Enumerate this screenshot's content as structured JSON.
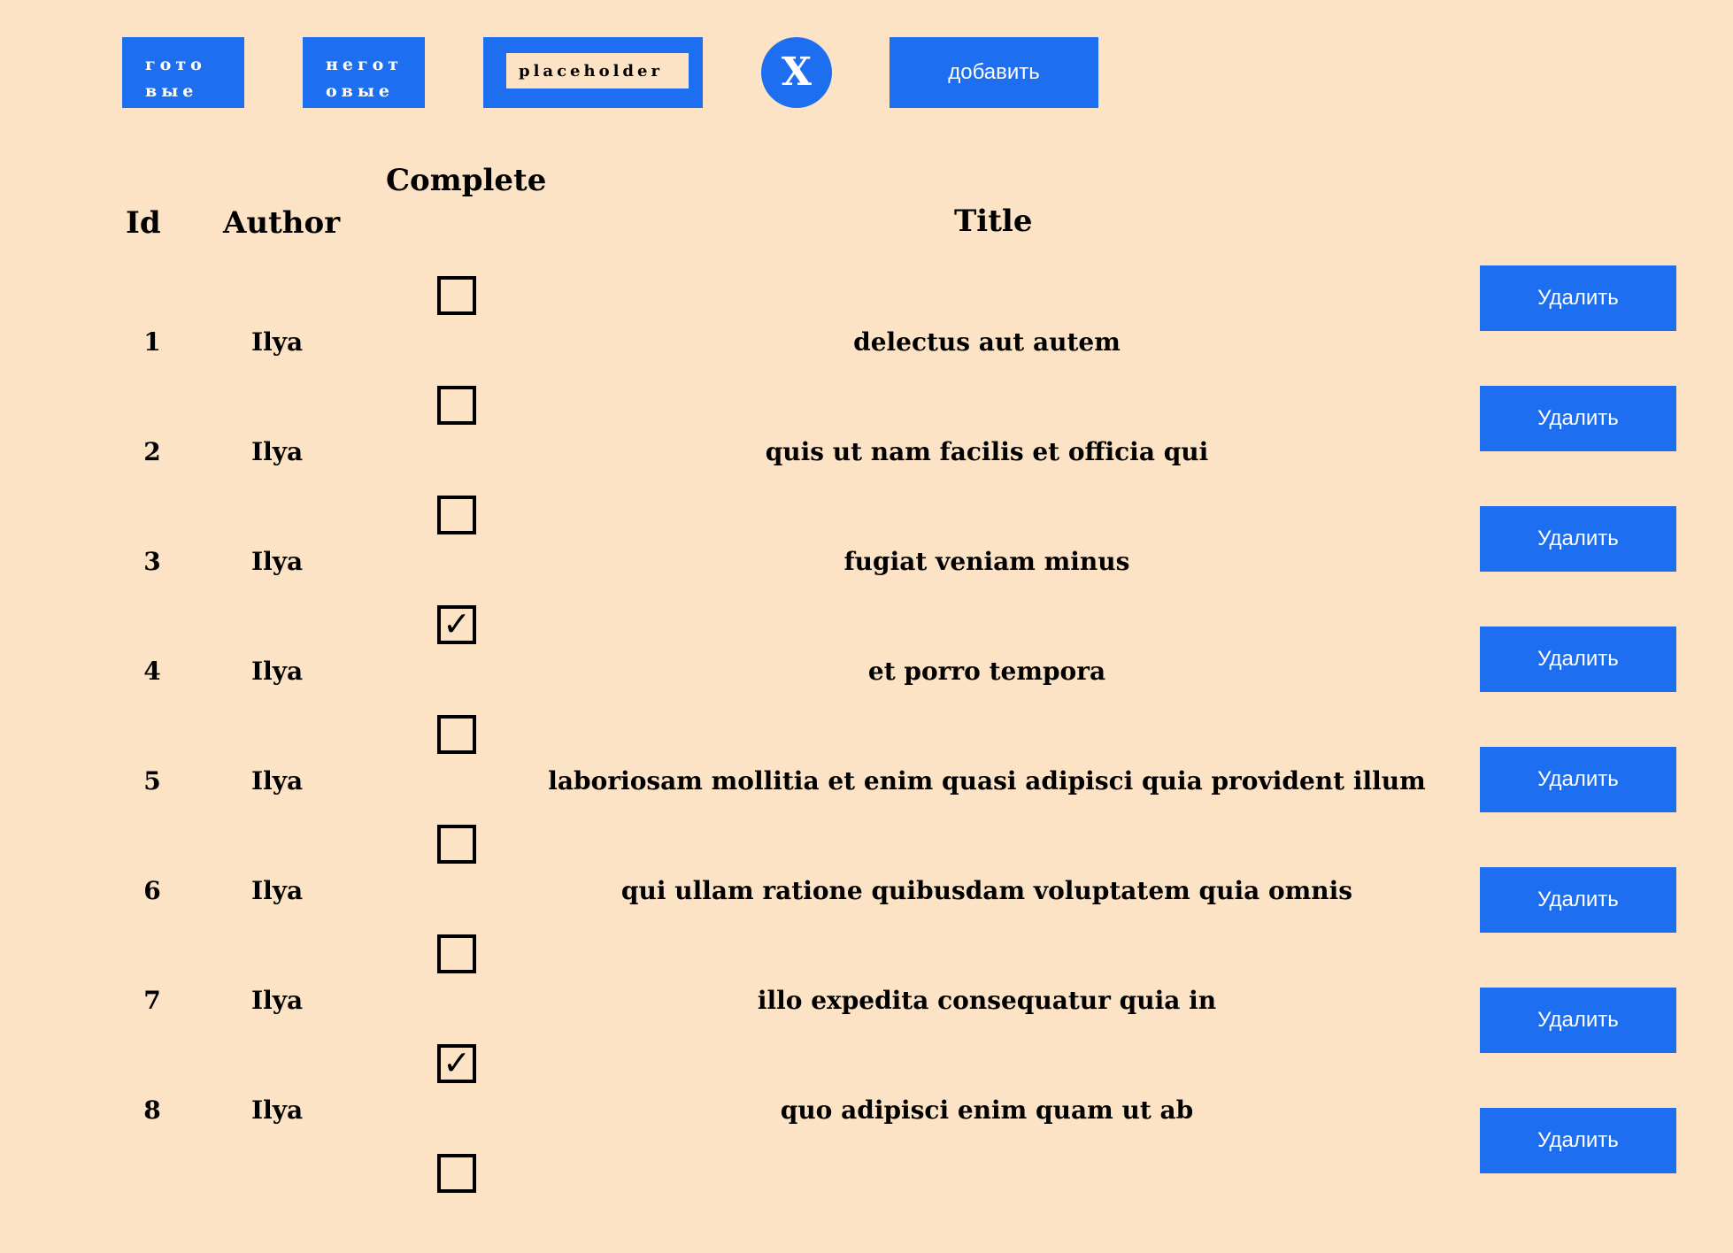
{
  "toolbar": {
    "filter_done_line1": "гото",
    "filter_done_line2": "вые",
    "filter_undone_line1": "негот",
    "filter_undone_line2": "овые",
    "search_placeholder": "placeholder",
    "search_value": "",
    "clear_label": "X",
    "add_label": "добавить"
  },
  "table": {
    "headers": {
      "id": "Id",
      "author": "Author",
      "complete": "Complete",
      "title": "Title"
    },
    "delete_label": "Удалить",
    "rows": [
      {
        "id": "1",
        "author": "Ilya",
        "title": "delectus aut autem",
        "complete": false,
        "check_mark": ""
      },
      {
        "id": "2",
        "author": "Ilya",
        "title": "quis ut nam facilis et officia qui",
        "complete": false,
        "check_mark": ""
      },
      {
        "id": "3",
        "author": "Ilya",
        "title": "fugiat veniam minus",
        "complete": false,
        "check_mark": ""
      },
      {
        "id": "4",
        "author": "Ilya",
        "title": "et porro tempora",
        "complete": true,
        "check_mark": "✓"
      },
      {
        "id": "5",
        "author": "Ilya",
        "title": "laboriosam mollitia et enim quasi adipisci quia provident illum",
        "complete": false,
        "check_mark": ""
      },
      {
        "id": "6",
        "author": "Ilya",
        "title": "qui ullam ratione quibusdam voluptatem quia omnis",
        "complete": false,
        "check_mark": ""
      },
      {
        "id": "7",
        "author": "Ilya",
        "title": "illo expedita consequatur quia in",
        "complete": false,
        "check_mark": ""
      },
      {
        "id": "8",
        "author": "Ilya",
        "title": "quo adipisci enim quam ut ab",
        "complete": true,
        "check_mark": "✓"
      }
    ],
    "trailing_checkbox": {
      "complete": false,
      "check_mark": ""
    }
  },
  "colors": {
    "background": "#fce3c5",
    "accent": "#1e6ef0"
  }
}
